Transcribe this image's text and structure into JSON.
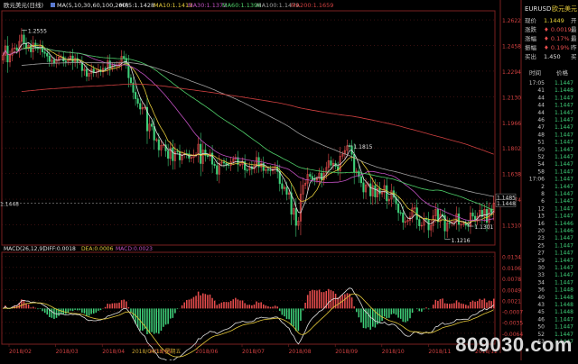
{
  "header": {
    "title": "欧元美元(日线)",
    "ma_label": "MA(5,10,30,60,100,200)",
    "ma_values": [
      {
        "label": "MA5:1.1428",
        "color": "#e0e0e0"
      },
      {
        "label": "MA10:1.1413",
        "color": "#e3c83a"
      },
      {
        "label": "MA30:1.1372",
        "color": "#c050c0"
      },
      {
        "label": "MA60:1.1396",
        "color": "#4fd06a"
      },
      {
        "label": "MA100:1.1479",
        "color": "#a0a0a0"
      },
      {
        "label": "MA200:1.1659",
        "color": "#d04040"
      }
    ]
  },
  "sidebar": {
    "symbol": "EURUSD",
    "name": "欧元美元",
    "quote_rows": [
      {
        "label": "现价",
        "value": "1.1449",
        "value_color": "#e8d23a",
        "extra": "开"
      },
      {
        "label": "涨跌",
        "value": "♦ 0.0019",
        "value_color": "#e84d4d",
        "extra": "最"
      },
      {
        "label": "涨幅",
        "value": "♦ 0.17%",
        "value_color": "#e84d4d",
        "extra": "最"
      },
      {
        "label": "振幅",
        "value": "♦ 0.19%",
        "value_color": "#e84d4d",
        "extra": "昨"
      },
      {
        "label": "买出",
        "value": "1.450",
        "value_color": "#e0e0e0",
        "extra": "买"
      }
    ],
    "ticks_header": {
      "time": "时间",
      "price": "价格"
    },
    "ticks": [
      {
        "time": "17:05",
        "price": "1.1447"
      },
      {
        "time": "41",
        "price": "1.1448"
      },
      {
        "time": "44",
        "price": "1.1447"
      },
      {
        "time": "44",
        "price": "1.1447"
      },
      {
        "time": "44",
        "price": "1.1447"
      },
      {
        "time": "46",
        "price": "1.1447"
      },
      {
        "time": "47",
        "price": "1.1447"
      },
      {
        "time": "48",
        "price": "1.1447"
      },
      {
        "time": "51",
        "price": "1.1447"
      },
      {
        "time": "50",
        "price": "1.1447"
      },
      {
        "time": "52",
        "price": "1.1447"
      },
      {
        "time": "54",
        "price": "1.1447"
      },
      {
        "time": "58",
        "price": "1.1447"
      },
      {
        "time": "17:06",
        "price": "1.1447"
      },
      {
        "time": "2",
        "price": "1.1447"
      },
      {
        "time": "8",
        "price": "1.1447"
      },
      {
        "time": "6",
        "price": "1.1447"
      },
      {
        "time": "12",
        "price": "1.1447"
      },
      {
        "time": "13",
        "price": "1.1447"
      },
      {
        "time": "16",
        "price": "1.1446"
      },
      {
        "time": "20",
        "price": "1.1446"
      },
      {
        "time": "23",
        "price": "1.1447"
      },
      {
        "time": "25",
        "price": "1.1447"
      },
      {
        "time": "27",
        "price": "1.1447"
      },
      {
        "time": "29",
        "price": "1.1447"
      },
      {
        "time": "30",
        "price": "1.1447"
      },
      {
        "time": "33",
        "price": "1.1447"
      },
      {
        "time": "34",
        "price": "1.1447"
      },
      {
        "time": "36",
        "price": "1.1448"
      },
      {
        "time": "40",
        "price": "1.1448"
      },
      {
        "time": "43",
        "price": "1.1448"
      },
      {
        "time": "45",
        "price": "1.1448"
      },
      {
        "time": "46",
        "price": "1.1447"
      },
      {
        "time": "50",
        "price": "1.1447"
      },
      {
        "time": "52",
        "price": "1.1447"
      },
      {
        "time": "53",
        "price": "1.1447"
      }
    ]
  },
  "watermark": "809030.com",
  "colors": {
    "up": "#e84d4d",
    "down": "#3fd07a",
    "grid": "#5a1a1a",
    "axis_text": "#d04040",
    "panel_border": "#7a2020"
  },
  "chart_data": {
    "type": "candlestick",
    "price_axis": {
      "ticks": [
        "1.2622",
        "1.2458",
        "1.2294",
        "1.2130",
        "1.1966",
        "1.1802",
        "1.1638",
        "1.1474",
        "1.1310"
      ],
      "ylim": [
        1.118,
        1.268
      ]
    },
    "x_axis": {
      "ticks": [
        "2018/02",
        "2018/03",
        "2018/04",
        "2018/05",
        "2018/06",
        "2018/07",
        "2018/08",
        "2018/09",
        "2018/10",
        "2018/11",
        "2018/12"
      ],
      "cursor_label": "2018/04/13 星期五"
    },
    "annotations": [
      {
        "label": "1.2555",
        "x": "2018/02",
        "value": 1.2555
      },
      {
        "label": "1.1815",
        "x": "2018/09",
        "value": 1.1815
      },
      {
        "label": "1.1301",
        "x": "2018/08",
        "value": 1.1301
      },
      {
        "label": "1.1216",
        "x": "2018/11",
        "value": 1.1216
      }
    ],
    "last_price_tags": [
      "1.1485",
      "1.1448"
    ],
    "reference_price_label": "1.1448",
    "close": [
      1.2395,
      1.2455,
      1.2352,
      1.2396,
      1.2438,
      1.2443,
      1.2427,
      1.2484,
      1.2525,
      1.2473,
      1.244,
      1.2459,
      1.2417,
      1.2473,
      1.2448,
      1.2437,
      1.2458,
      1.2416,
      1.2407,
      1.239,
      1.2355,
      1.2365,
      1.2344,
      1.2367,
      1.2383,
      1.2386,
      1.2358,
      1.2354,
      1.2367,
      1.2391,
      1.235,
      1.2376,
      1.2348,
      1.2352,
      1.2297,
      1.2306,
      1.2261,
      1.228,
      1.2306,
      1.2283,
      1.2288,
      1.2304,
      1.2289,
      1.2311,
      1.2309,
      1.2359,
      1.2312,
      1.233,
      1.2329,
      1.2329,
      1.2342,
      1.2389,
      1.2376,
      1.2341,
      1.2251,
      1.2219,
      1.2158,
      1.2117,
      1.2087,
      1.2051,
      1.2061,
      1.2062,
      1.1911,
      1.1955,
      1.194,
      1.1852,
      1.1855,
      1.1789,
      1.1819,
      1.1822,
      1.1783,
      1.1735,
      1.1803,
      1.172,
      1.178,
      1.1779,
      1.1725,
      1.1759,
      1.1766,
      1.1765,
      1.1736,
      1.1741,
      1.1759,
      1.1759,
      1.1826,
      1.1702,
      1.1789,
      1.1754,
      1.1747,
      1.1769,
      1.1698,
      1.1689,
      1.1634,
      1.1705,
      1.1712,
      1.1705,
      1.1694,
      1.169,
      1.1713,
      1.1732,
      1.1741,
      1.1696,
      1.1696,
      1.1714,
      1.1661,
      1.166,
      1.1682,
      1.1667,
      1.1688,
      1.1741,
      1.168,
      1.1704,
      1.1657,
      1.1663,
      1.166,
      1.1655,
      1.1667,
      1.1682,
      1.1651,
      1.1573,
      1.1541,
      1.1551,
      1.1505,
      1.1515,
      1.1377,
      1.1414,
      1.1306,
      1.1334,
      1.1506,
      1.1563,
      1.1577,
      1.1633,
      1.162,
      1.1603,
      1.1595,
      1.1606,
      1.1641,
      1.1597,
      1.1641,
      1.1677,
      1.172,
      1.1691,
      1.1704,
      1.1684,
      1.1657,
      1.175,
      1.1763,
      1.1786,
      1.1816,
      1.1812,
      1.1761,
      1.1647,
      1.1654,
      1.1618,
      1.1579,
      1.152,
      1.1566,
      1.1573,
      1.1494,
      1.1561,
      1.1488,
      1.1542,
      1.1508,
      1.1518,
      1.1561,
      1.1463,
      1.1474,
      1.1528,
      1.1486,
      1.1444,
      1.1388,
      1.1386,
      1.1326,
      1.133,
      1.1339,
      1.136,
      1.1417,
      1.1419,
      1.1344,
      1.1303,
      1.1306,
      1.1347,
      1.1346,
      1.1277,
      1.1305,
      1.1367,
      1.1409,
      1.1329,
      1.1377,
      1.1369,
      1.127,
      1.1323,
      1.1319,
      1.1327,
      1.1331,
      1.138,
      1.1312,
      1.1312,
      1.1319,
      1.1307,
      1.13,
      1.1386,
      1.1365,
      1.1334,
      1.1363,
      1.1403,
      1.1363,
      1.1409,
      1.1326,
      1.1411,
      1.139,
      1.1449
    ],
    "ma_series": [
      {
        "name": "MA5",
        "period": 5,
        "color": "#e0e0e0"
      },
      {
        "name": "MA10",
        "period": 10,
        "color": "#e3c83a"
      },
      {
        "name": "MA30",
        "period": 30,
        "color": "#c050c0"
      },
      {
        "name": "MA60",
        "period": 60,
        "color": "#4fd06a"
      },
      {
        "name": "MA100",
        "period": 100,
        "color": "#a0a0a0"
      },
      {
        "name": "MA200",
        "period": 200,
        "color": "#d04040"
      }
    ],
    "macd": {
      "label": "MACD(26,12,9)",
      "diff_label": "DIFF:0.0018",
      "dea_label": "DEA:0.0006",
      "macd_label": "MACD:0.0023",
      "ticks": [
        "0.0134",
        "0.0106",
        "0.0078",
        "0.0049",
        "0.0021",
        "-0.0007",
        "-0.0035",
        "-0.0064"
      ],
      "ylim": [
        -0.0092,
        0.0145
      ]
    }
  }
}
